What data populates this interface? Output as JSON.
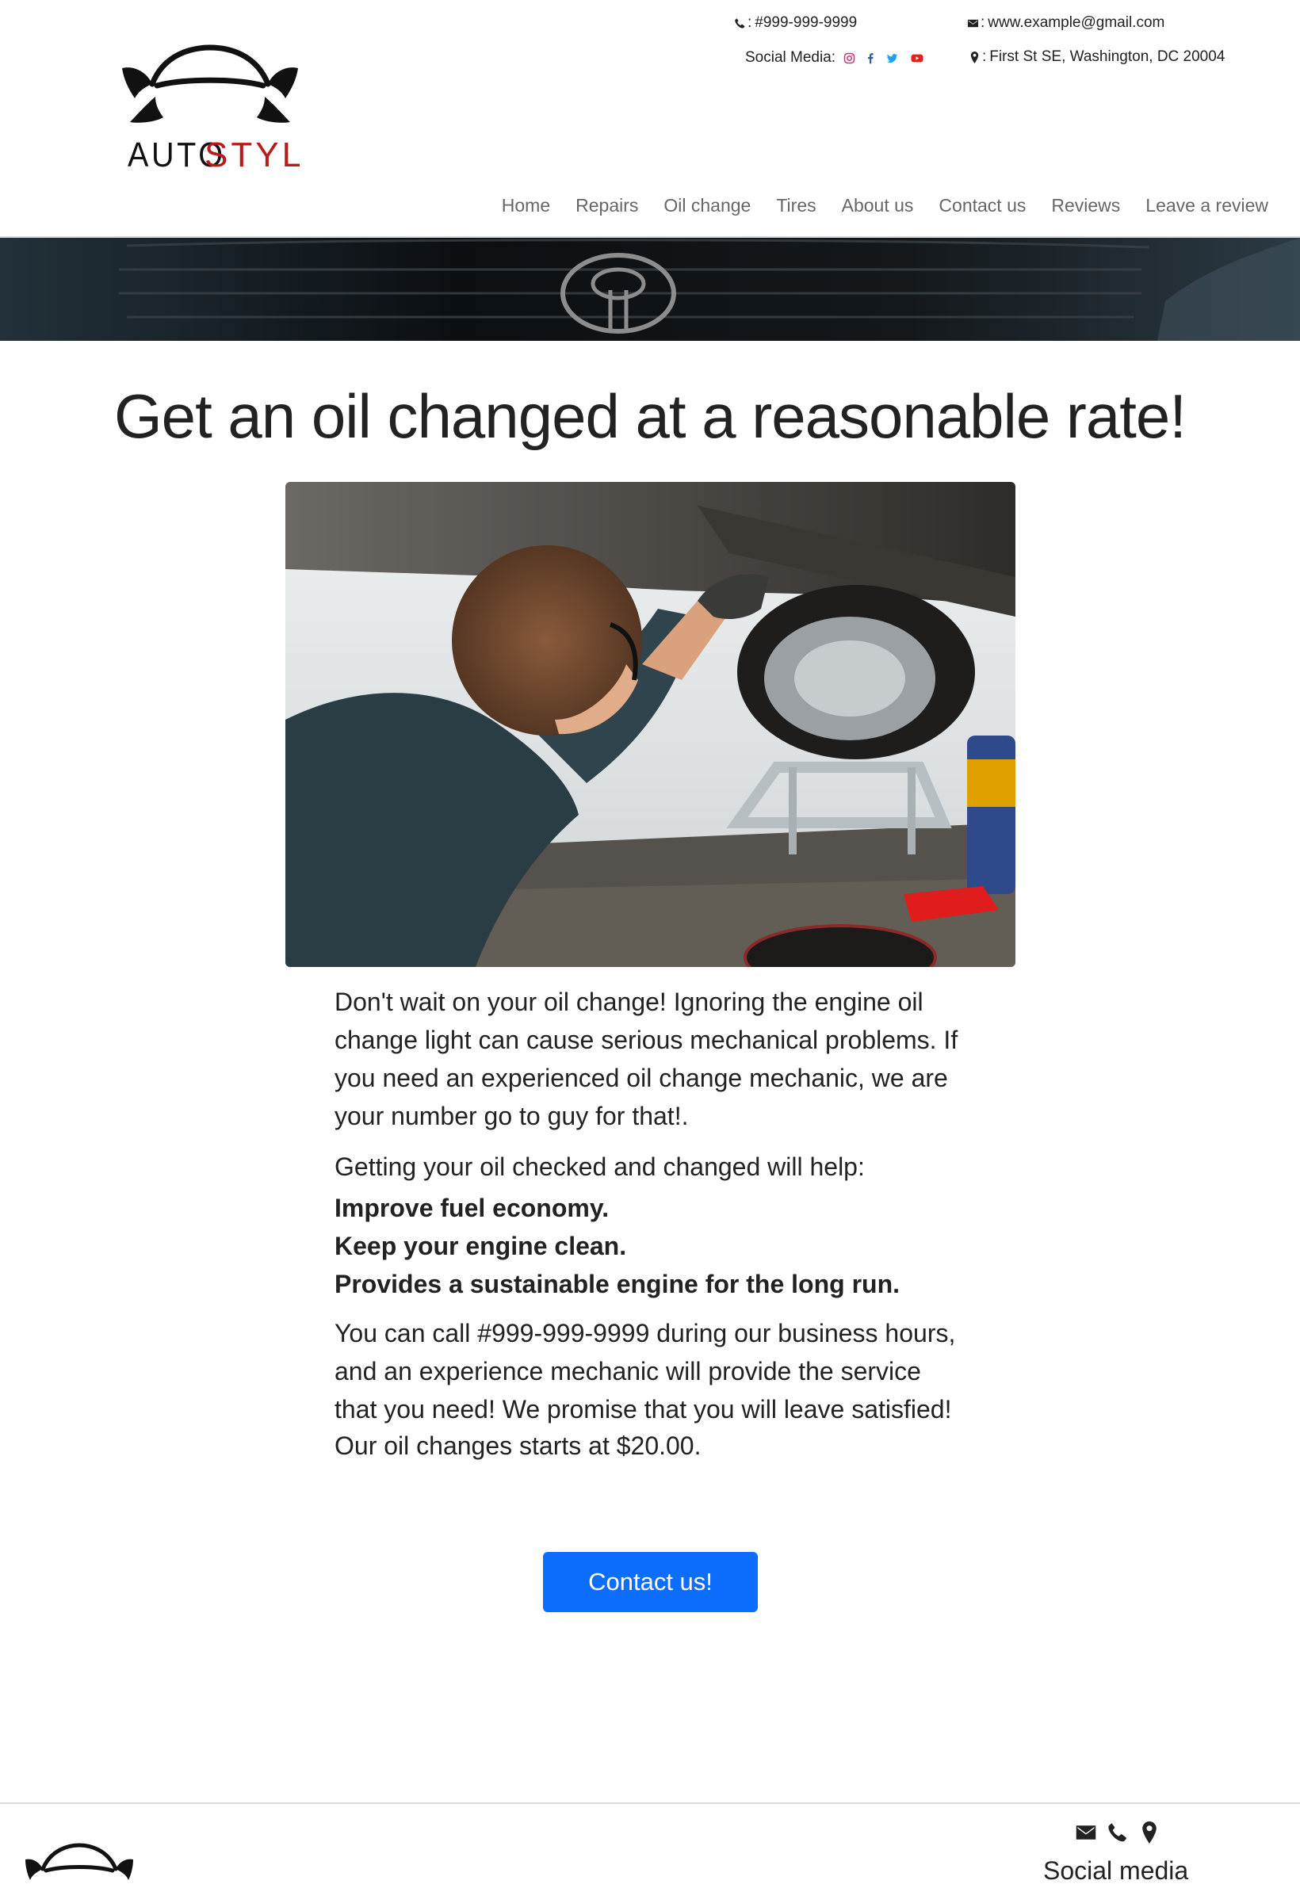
{
  "header": {
    "phone": "#999-999-9999",
    "email": "www.example@gmail.com",
    "social_label": "Social Media:",
    "address": "First St SE, Washington, DC 20004",
    "separator": ":",
    "logo": {
      "part1": "AUTO",
      "part2": "STYLE",
      "accent_color": "#b71c1c"
    }
  },
  "nav": {
    "items": [
      "Home",
      "Repairs",
      "Oil change",
      "Tires",
      "About us",
      "Contact us",
      "Reviews",
      "Leave a review"
    ]
  },
  "main": {
    "headline": "Get an oil changed at a reasonable rate!",
    "intro": "Don't wait on your oil change! Ignoring the engine oil change light can cause serious mechanical problems. If you need an experienced oil change mechanic, we are your number go to guy for that!.",
    "benefits_intro": "Getting your oil checked and changed will help:",
    "benefits": [
      "Improve fuel economy.",
      "Keep your engine clean.",
      "Provides a sustainable engine for the long run."
    ],
    "call_text": "You can call #999-999-9999 during our business hours, and an experience mechanic will provide the service that you need! We promise that you will leave satisfied!",
    "price_text": "Our oil changes starts at $20.00.",
    "cta_label": "Contact us!"
  },
  "footer": {
    "social_label": "Social media"
  },
  "icons": [
    "phone-icon",
    "email-icon",
    "location-icon",
    "instagram-icon",
    "facebook-icon",
    "twitter-icon",
    "youtube-icon"
  ],
  "colors": {
    "accent": "#0d6efd",
    "logo_red": "#b71c1c",
    "instagram": "#c13584",
    "facebook": "#3b5998",
    "twitter": "#1da1f2",
    "youtube": "#e62117"
  }
}
